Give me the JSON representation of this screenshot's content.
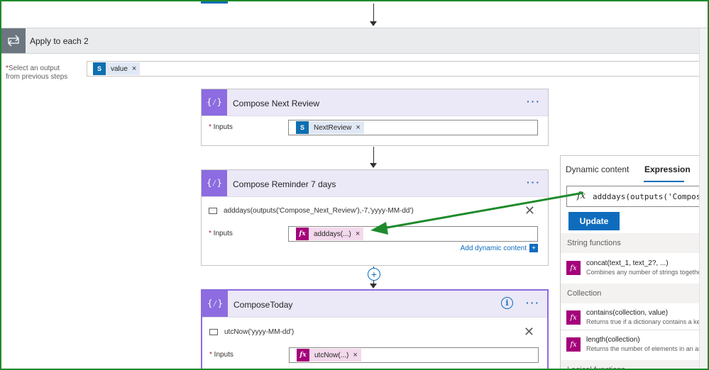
{
  "apply": {
    "title": "Apply to each 2"
  },
  "select_output": {
    "label_line1": "Select an output",
    "label_line2": "from previous steps",
    "token": "value"
  },
  "cards": [
    {
      "title": "Compose Next Review",
      "inputs_label": "Inputs",
      "token": "NextReview",
      "menu": "···"
    },
    {
      "title": "Compose Reminder 7 days",
      "inputs_label": "Inputs",
      "expression": "adddays(outputs('Compose_Next_Review'),-7,'yyyy-MM-dd')",
      "token": "adddays(...)",
      "add_dynamic": "Add dynamic content",
      "menu": "···"
    },
    {
      "title": "ComposeToday",
      "inputs_label": "Inputs",
      "expression": "utcNow('yyyy-MM-dd')",
      "token": "utcNow(...)",
      "menu": "···"
    }
  ],
  "panel": {
    "tabs": [
      "Dynamic content",
      "Expression"
    ],
    "active_tab": "Expression",
    "expression_value": "adddays(outputs('Compose_N",
    "update_label": "Update",
    "sections": [
      {
        "title": "String functions",
        "items": [
          {
            "name": "concat(text_1, text_2?, ...)",
            "desc": "Combines any number of strings together"
          }
        ]
      },
      {
        "title": "Collection",
        "items": [
          {
            "name": "contains(collection, value)",
            "desc": "Returns true if a dictionary contains a key"
          },
          {
            "name": "length(collection)",
            "desc": "Returns the number of elements in an array"
          }
        ]
      },
      {
        "title": "Logical functions",
        "items": []
      }
    ]
  },
  "colors": {
    "accent": "#0f6cbd",
    "compose": "#8c6ce0",
    "fx": "#a4007a",
    "sharepoint": "#0f6fb0",
    "annotation_arrow": "#1e8a2b"
  },
  "icons": {
    "apply": "loop-icon",
    "compose": "compose-braces-icon",
    "sharepoint": "sharepoint-icon",
    "fx": "function-icon"
  }
}
